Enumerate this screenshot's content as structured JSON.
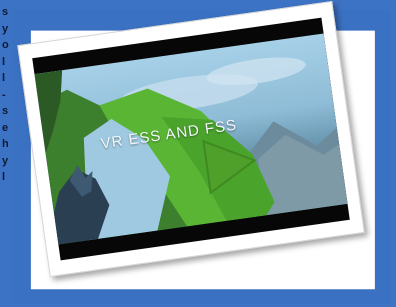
{
  "side_text": [
    "s",
    "y",
    "o",
    "l",
    "l",
    "-",
    "s",
    "e",
    "h",
    "y",
    "l"
  ],
  "video": {
    "title": "VR ESS AND FSS",
    "play_label": "Play"
  },
  "colors": {
    "background": "#3d73c4",
    "play_button": "#4fa02a"
  }
}
